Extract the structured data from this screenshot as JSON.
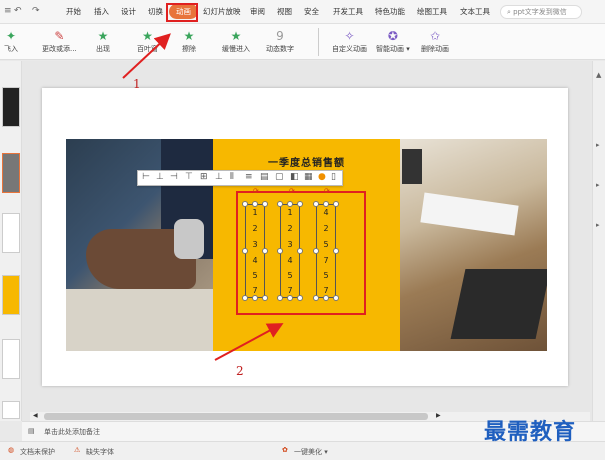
{
  "menubar": {
    "quick_access": [
      "↶",
      "↷"
    ],
    "tabs": [
      "开始",
      "插入",
      "设计",
      "切换",
      "动画",
      "幻灯片放映",
      "审阅",
      "视图",
      "安全",
      "开发工具",
      "特色功能",
      "绘图工具",
      "文本工具"
    ],
    "active_tab": "动画",
    "search_placeholder": "ppt文字发到微信"
  },
  "ribbon": {
    "items": [
      {
        "label": "飞入",
        "icon": "fly-in-icon"
      },
      {
        "label": "更改或添...",
        "icon": "pen-icon"
      },
      {
        "label": "出现",
        "icon": "appear-icon"
      },
      {
        "label": "百叶窗",
        "icon": "blinds-icon"
      },
      {
        "label": "擦除",
        "icon": "wipe-icon"
      },
      {
        "label": "缓慢进入",
        "icon": "slow-in-icon"
      },
      {
        "label": "动态数字",
        "icon": "dynamic-number-icon"
      },
      {
        "label": "自定义动画",
        "icon": "custom-animation-icon"
      },
      {
        "label": "智能动画 ▾",
        "icon": "smart-animation-icon"
      },
      {
        "label": "删除动画",
        "icon": "delete-animation-icon"
      }
    ]
  },
  "slide": {
    "title": "一季度总销售额",
    "columns": [
      [
        "1",
        "2",
        "3",
        "4",
        "5",
        "7"
      ],
      [
        "1",
        "2",
        "3",
        "4",
        "5",
        "7"
      ],
      [
        "4",
        "2",
        "5",
        "7",
        "5",
        "7"
      ]
    ]
  },
  "annotations": {
    "arrow1_label": "1",
    "arrow2_label": "2"
  },
  "notes": {
    "placeholder": "单击此处添加备注"
  },
  "status": {
    "doc_protect": "文档未保护",
    "missing_font": "缺失字体",
    "beautify": "一键美化 ▾"
  },
  "watermark": "最需教育",
  "colors": {
    "accent": "#e8743b",
    "slide_yellow": "#f7b800",
    "annotation_red": "#e02020"
  }
}
